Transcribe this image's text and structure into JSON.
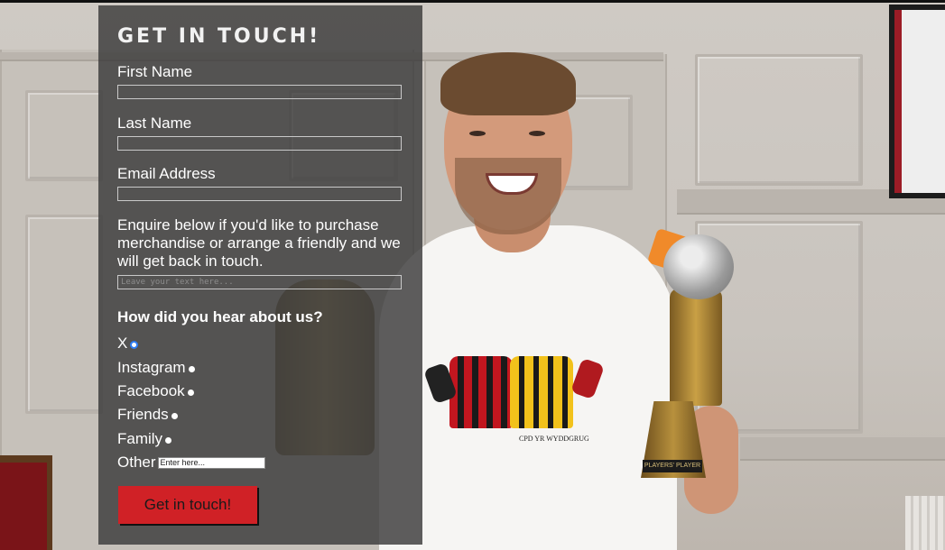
{
  "form": {
    "title": "GET IN TOUCH!",
    "first_name_label": "First Name",
    "last_name_label": "Last Name",
    "email_label": "Email Address",
    "enquire_text": "Enquire below if you'd like to purchase merchandise or arrange a friendly and we will get back in touch.",
    "message_placeholder": "Leave your text here...",
    "question": "How did you hear about us?",
    "options": [
      {
        "label": "X",
        "selected": true
      },
      {
        "label": "Instagram",
        "selected": false
      },
      {
        "label": "Facebook",
        "selected": false
      },
      {
        "label": "Friends",
        "selected": false
      },
      {
        "label": "Family",
        "selected": false
      },
      {
        "label": "Other",
        "selected": false
      }
    ],
    "other_placeholder": "Enter here...",
    "submit_label": "Get in touch!"
  },
  "background": {
    "shirt_text": "CPD YR WYDDGRUG",
    "trophy_plate": "PLAYERS' PLAYER"
  },
  "colors": {
    "panel": "#3a3a3a",
    "submit": "#d02126",
    "radio_selected": "#2f7ef5"
  }
}
